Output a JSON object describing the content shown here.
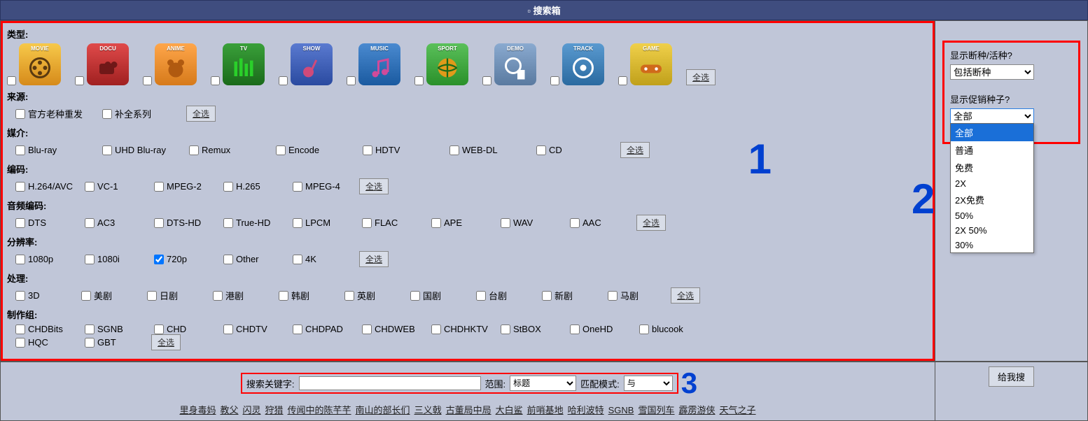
{
  "header": {
    "title": "搜索箱"
  },
  "categories": {
    "label": "类型:",
    "items": [
      {
        "name": "MOVIE",
        "bg": "linear-gradient(#f7c94a,#d68a1a)",
        "icon": "movie"
      },
      {
        "name": "DOCU",
        "bg": "linear-gradient(#e04a4a,#a02020)",
        "icon": "docu"
      },
      {
        "name": "ANIME",
        "bg": "linear-gradient(#ffa64a,#d67a1a)",
        "icon": "anime"
      },
      {
        "name": "TV",
        "bg": "linear-gradient(#3aa03a,#1a6a1a)",
        "icon": "tv"
      },
      {
        "name": "SHOW",
        "bg": "linear-gradient(#5a7ad0,#2a4aa0)",
        "icon": "show"
      },
      {
        "name": "MUSIC",
        "bg": "linear-gradient(#4a8ad0,#1a5aa0)",
        "icon": "music"
      },
      {
        "name": "SPORT",
        "bg": "linear-gradient(#5ac05a,#2a902a)",
        "icon": "sport"
      },
      {
        "name": "DEMO",
        "bg": "linear-gradient(#8aaad0,#5a7aa0)",
        "icon": "demo"
      },
      {
        "name": "TRACK",
        "bg": "linear-gradient(#5a9ad0,#2a6aa0)",
        "icon": "track"
      },
      {
        "name": "GAME",
        "bg": "linear-gradient(#f0d04a,#c0a01a)",
        "icon": "game"
      }
    ],
    "select_all": "全选"
  },
  "source": {
    "label": "来源:",
    "items": [
      "官方老种重发",
      "补全系列"
    ],
    "select_all": "全选"
  },
  "medium": {
    "label": "媒介:",
    "items": [
      "Blu-ray",
      "UHD Blu-ray",
      "Remux",
      "Encode",
      "HDTV",
      "WEB-DL",
      "CD"
    ],
    "select_all": "全选"
  },
  "codec": {
    "label": "编码:",
    "items": [
      "H.264/AVC",
      "VC-1",
      "MPEG-2",
      "H.265",
      "MPEG-4"
    ],
    "select_all": "全选"
  },
  "audio": {
    "label": "音频编码:",
    "items": [
      "DTS",
      "AC3",
      "DTS-HD",
      "True-HD",
      "LPCM",
      "FLAC",
      "APE",
      "WAV",
      "AAC"
    ],
    "select_all": "全选"
  },
  "resolution": {
    "label": "分辨率:",
    "items": [
      {
        "label": "1080p",
        "checked": false
      },
      {
        "label": "1080i",
        "checked": false
      },
      {
        "label": "720p",
        "checked": true
      },
      {
        "label": "Other",
        "checked": false
      },
      {
        "label": "4K",
        "checked": false
      }
    ],
    "select_all": "全选"
  },
  "process": {
    "label": "处理:",
    "items": [
      "3D",
      "美剧",
      "日剧",
      "港剧",
      "韩剧",
      "英剧",
      "国剧",
      "台剧",
      "新剧",
      "马剧"
    ],
    "select_all": "全选"
  },
  "team": {
    "label": "制作组:",
    "row1": [
      "CHDBits",
      "SGNB",
      "CHD",
      "CHDTV",
      "CHDPAD",
      "CHDWEB",
      "CHDHKTV",
      "StBOX",
      "OneHD",
      "blucook"
    ],
    "row2": [
      "HQC",
      "GBT"
    ],
    "select_all": "全选"
  },
  "right": {
    "dead_label": "显示断种/活种?",
    "dead_value": "包括断种",
    "promo_label": "显示促销种子?",
    "promo_value": "全部",
    "promo_options": [
      "全部",
      "普通",
      "免费",
      "2X",
      "2X免费",
      "50%",
      "2X 50%",
      "30%"
    ]
  },
  "search": {
    "keyword_label": "搜索关键字:",
    "range_label": "范围:",
    "range_value": "标题",
    "mode_label": "匹配模式:",
    "mode_value": "与"
  },
  "hot_links": [
    "里身毒妈",
    "教父",
    "闪灵",
    "狩猎",
    "传闻中的陈芊芊",
    "南山的部长们",
    "三义戟",
    "古董局中局",
    "大白鲨",
    "前哨基地",
    "哈利波特",
    "SGNB",
    "雪国列车",
    "霹雳游侠",
    "天气之子"
  ],
  "submit": "给我搜",
  "annotations": {
    "n1": "1",
    "n2": "2",
    "n3": "3"
  }
}
